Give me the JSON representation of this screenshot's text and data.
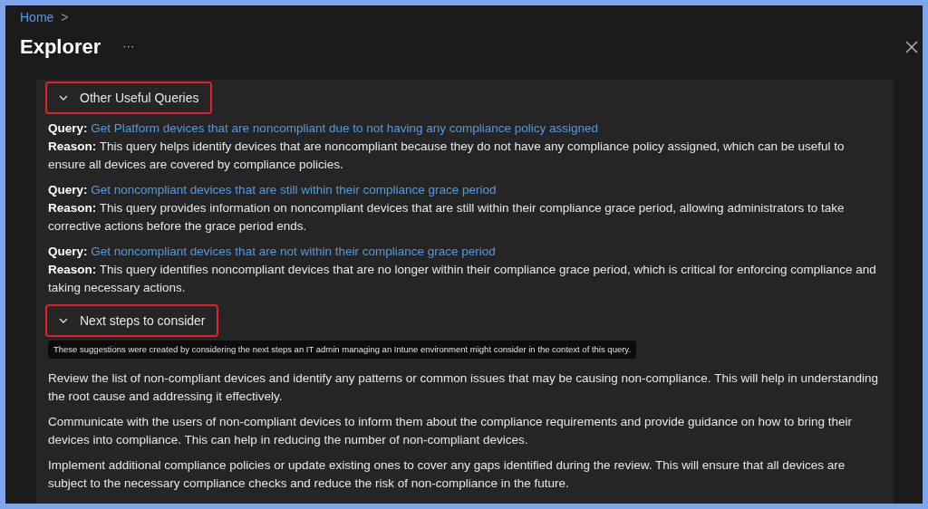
{
  "breadcrumb": {
    "items": [
      "Home"
    ],
    "separator": ">"
  },
  "title": "Explorer",
  "more": "···",
  "sections": [
    {
      "kind": "queries",
      "title": "Other Useful Queries",
      "expanded": true,
      "highlighted": true,
      "items": [
        {
          "query_label": "Query:",
          "query": "Get Platform devices that are noncompliant due to not having any compliance policy assigned",
          "reason_label": "Reason:",
          "reason": "This query helps identify devices that are noncompliant because they do not have any compliance policy assigned, which can be useful to ensure all devices are covered by compliance policies."
        },
        {
          "query_label": "Query:",
          "query": "Get noncompliant devices that are still within their compliance grace period",
          "reason_label": "Reason:",
          "reason": "This query provides information on noncompliant devices that are still within their compliance grace period, allowing administrators to take corrective actions before the grace period ends."
        },
        {
          "query_label": "Query:",
          "query": "Get noncompliant devices that are not within their compliance grace period",
          "reason_label": "Reason:",
          "reason": "This query identifies noncompliant devices that are no longer within their compliance grace period, which is critical for enforcing compliance and taking necessary actions."
        }
      ]
    },
    {
      "kind": "steps",
      "title": "Next steps to consider",
      "expanded": true,
      "highlighted": true,
      "tooltip": "These suggestions were created by considering the next steps an IT admin managing an Intune environment might consider in the context of this query.",
      "items": [
        "Review the list of non-compliant devices and identify any patterns or common issues that may be causing non-compliance. This will help in understanding the root cause and addressing it effectively.",
        "Communicate with the users of non-compliant devices to inform them about the compliance requirements and provide guidance on how to bring their devices into compliance. This can help in reducing the number of non-compliant devices.",
        "Implement additional compliance policies or update existing ones to cover any gaps identified during the review. This will ensure that all devices are subject to the necessary compliance checks and reduce the risk of non-compliance in the future."
      ]
    }
  ]
}
